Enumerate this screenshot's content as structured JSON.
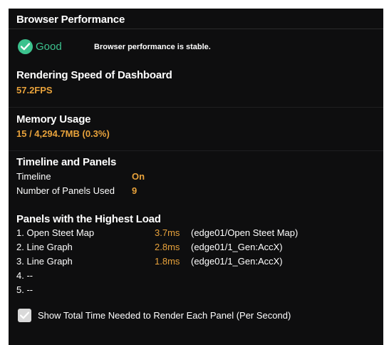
{
  "header": {
    "title": "Browser Performance"
  },
  "status": {
    "label": "Good",
    "message": "Browser performance is stable.",
    "icon": "check-circle-icon",
    "color": "#3cc28e"
  },
  "rendering": {
    "title": "Rendering Speed of Dashboard",
    "value": "57.2FPS"
  },
  "memory": {
    "title": "Memory Usage",
    "value": "15 / 4,294.7MB (0.3%)"
  },
  "timeline": {
    "title": "Timeline and Panels",
    "rows": [
      {
        "label": "Timeline",
        "value": "On"
      },
      {
        "label": "Number of Panels Used",
        "value": "9"
      }
    ]
  },
  "load": {
    "title": "Panels with the Highest Load",
    "rows": [
      {
        "rank": "1. Open Steet Map",
        "time": "3.7ms",
        "source": "(edge01/Open Steet Map)"
      },
      {
        "rank": "2. Line Graph",
        "time": "2.8ms",
        "source": "(edge01/1_Gen:AccX)"
      },
      {
        "rank": "3. Line Graph",
        "time": "1.8ms",
        "source": "(edge01/1_Gen:AccX)"
      },
      {
        "rank": "4. --",
        "time": "",
        "source": ""
      },
      {
        "rank": "5. --",
        "time": "",
        "source": ""
      }
    ]
  },
  "option": {
    "label": "Show Total Time Needed to Render Each Panel (Per Second)",
    "checked": true
  },
  "colors": {
    "accent": "#e8a23b",
    "background": "#0e0e0f",
    "good": "#3cc28e"
  }
}
